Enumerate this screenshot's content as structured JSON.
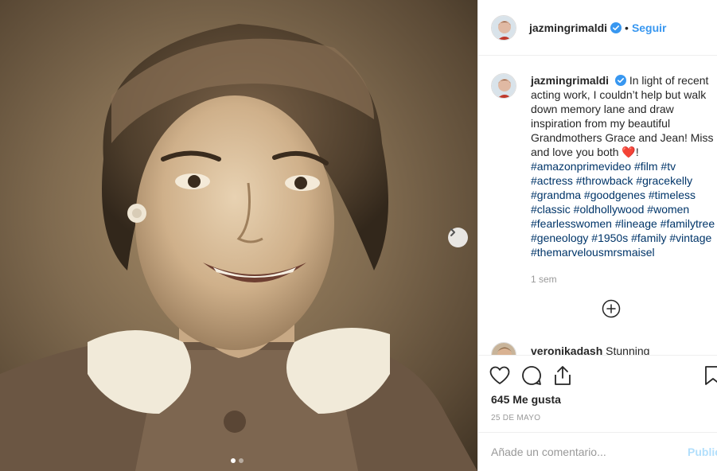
{
  "post": {
    "photo_alt": "Vintage sepia portrait",
    "carousel": {
      "slides": 2,
      "active": 1
    }
  },
  "header": {
    "username": "jazmingrimaldi",
    "separator": "•",
    "follow_label": "Seguir"
  },
  "caption": {
    "username": "jazmingrimaldi",
    "lines": [
      "In light of recent",
      "acting work, I couldn’t help but walk",
      "down memory lane and draw",
      "inspiration from my beautiful",
      "Grandmothers Grace and Jean! Miss",
      "and love you both ❤️!"
    ],
    "hashtag_lines": [
      "#amazonprimevideo #film #tv",
      "#actress #throwback #gracekelly",
      "#grandma #goodgenes #timeless",
      "#classic #oldhollywood #women",
      "#fearlesswomen #lineage #familytree",
      "#geneology #1950s #family #vintage",
      "#themarvelousmrsmaisel"
    ],
    "time": "1 sem"
  },
  "comment": {
    "username": "veronikadash",
    "text": "Stunning"
  },
  "actions": {
    "likes": "645 Me gusta",
    "date": "25 DE MAYO"
  },
  "add_comment": {
    "placeholder": "Añade un comentario...",
    "publish_label": "Publicar"
  },
  "icons": {
    "verified": "verified-badge-icon",
    "next": "chevron-right-icon",
    "more": "plus-circle-icon",
    "like": "heart-icon",
    "comment": "comment-bubble-icon",
    "share": "share-icon",
    "save": "bookmark-icon"
  },
  "colors": {
    "link": "#3897f0",
    "hashtag": "#003569",
    "heart": "#ed4956",
    "muted": "#999999"
  }
}
